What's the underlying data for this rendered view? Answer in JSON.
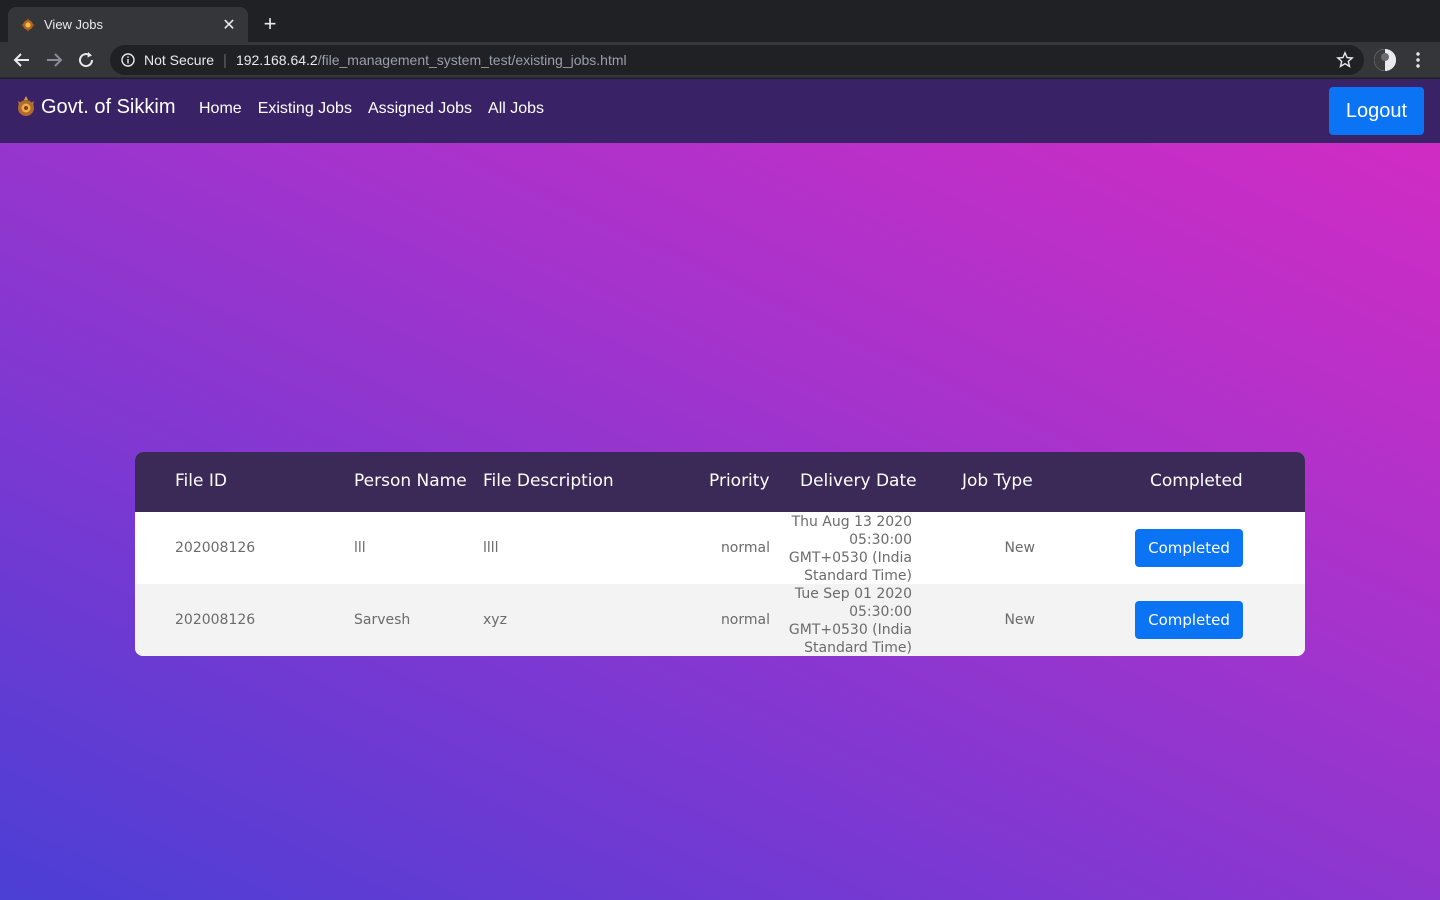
{
  "browser": {
    "tab_title": "View Jobs",
    "security_label": "Not Secure",
    "url_host": "192.168.64.2",
    "url_path": "/file_management_system_test/existing_jobs.html"
  },
  "navbar": {
    "brand": "Govt. of Sikkim",
    "links": [
      "Home",
      "Existing Jobs",
      "Assigned Jobs",
      "All Jobs"
    ],
    "logout_label": "Logout"
  },
  "table": {
    "headers": [
      "File ID",
      "Person Name",
      "File Description",
      "Priority",
      "Delivery Date",
      "Job Type",
      "Completed"
    ],
    "rows": [
      {
        "file_id": "202008126",
        "person_name": "lll",
        "file_description": "llll",
        "priority": "normal",
        "delivery_date_lines": [
          "Thu Aug 13 2020",
          "05:30:00",
          "GMT+0530 (India",
          "Standard Time)"
        ],
        "job_type": "New",
        "action": "Completed"
      },
      {
        "file_id": "202008126",
        "person_name": "Sarvesh",
        "file_description": "xyz",
        "priority": "normal",
        "delivery_date_lines": [
          "Tue Sep 01 2020",
          "05:30:00",
          "GMT+0530 (India",
          "Standard Time)"
        ],
        "job_type": "New",
        "action": "Completed"
      }
    ]
  },
  "colors": {
    "navbar_bg": "#3a2267",
    "table_header_bg": "#3b2a57",
    "primary_button": "#0b74f5",
    "gradient_top_right": "#d62bc2",
    "gradient_bottom_left": "#4b3fd4"
  }
}
